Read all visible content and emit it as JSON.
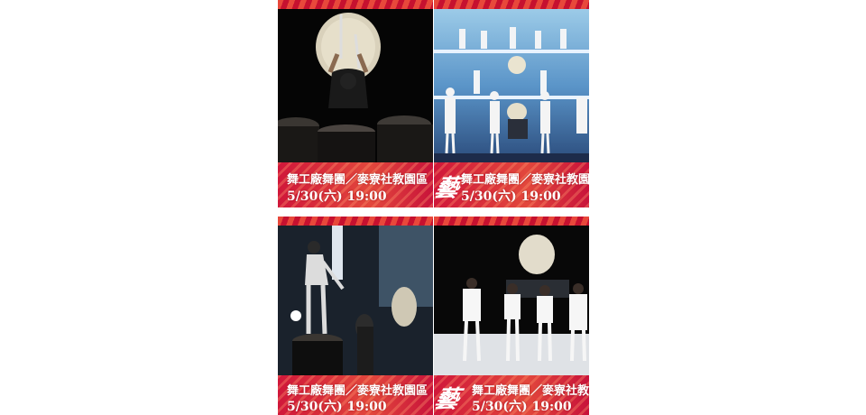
{
  "panels": [
    {
      "caption_line1": "舞工廠舞團／麥寮社教園區",
      "caption_line2": "5/30(六) 19:00"
    },
    {
      "caption_line1": "舞工廠舞團／麥寮社教園區",
      "caption_line2": "5/30(六) 19:00"
    },
    {
      "caption_line1": "舞工廠舞團／麥寮社教園區",
      "caption_line2": "5/30(六) 19:00"
    },
    {
      "caption_line1": "舞工廠舞團／麥寮社教園",
      "caption_line2": "5/30(六) 19:00"
    }
  ],
  "logo_text": "藝",
  "colors": {
    "brand_red": "#d8173a",
    "accent_orange": "#e8483b"
  }
}
